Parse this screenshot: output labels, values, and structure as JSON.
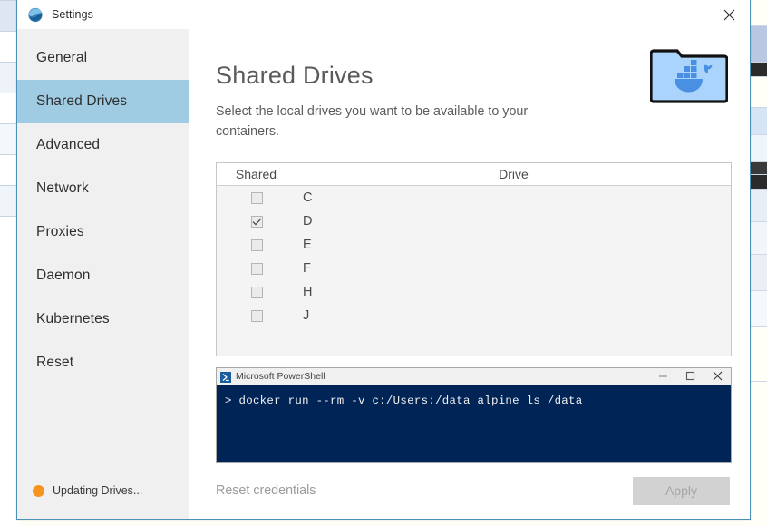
{
  "window": {
    "title": "Settings",
    "title_icon": "docker-whale-icon",
    "close_icon": "close-icon"
  },
  "background": {
    "description": "spreadsheet-behind-window"
  },
  "sidebar": {
    "items": [
      {
        "label": "General",
        "selected": false
      },
      {
        "label": "Shared Drives",
        "selected": true
      },
      {
        "label": "Advanced",
        "selected": false
      },
      {
        "label": "Network",
        "selected": false
      },
      {
        "label": "Proxies",
        "selected": false
      },
      {
        "label": "Daemon",
        "selected": false
      },
      {
        "label": "Kubernetes",
        "selected": false
      },
      {
        "label": "Reset",
        "selected": false
      }
    ],
    "status": {
      "text": "Updating Drives...",
      "dot_color": "#f79420",
      "dot_icon": "status-dot-icon"
    }
  },
  "main": {
    "title": "Shared Drives",
    "description": "Select the local drives you want to be available to your containers.",
    "hero_icon": "shared-folder-docker-icon",
    "table": {
      "columns": [
        "Shared",
        "Drive"
      ],
      "rows": [
        {
          "drive": "C",
          "shared": false
        },
        {
          "drive": "D",
          "shared": true
        },
        {
          "drive": "E",
          "shared": false
        },
        {
          "drive": "F",
          "shared": false
        },
        {
          "drive": "H",
          "shared": false
        },
        {
          "drive": "J",
          "shared": false
        }
      ]
    },
    "console": {
      "title": "Microsoft PowerShell",
      "icon": "powershell-icon",
      "prompt": ">",
      "command": "docker run --rm -v c:/Users:/data alpine ls /data",
      "line": "> docker run --rm -v c:/Users:/data alpine ls /data",
      "background_color": "#012456",
      "buttons": {
        "minimize": "minimize-icon",
        "maximize": "maximize-icon",
        "close": "close-icon"
      }
    },
    "footer": {
      "reset_credentials_label": "Reset credentials",
      "apply_label": "Apply",
      "apply_enabled": false
    }
  },
  "colors": {
    "accent_selected": "#9fcbe3",
    "window_border": "#4a90b8",
    "sidebar_bg": "#f0f0f0",
    "status_orange": "#f79420",
    "console_navy": "#012456",
    "folder_blue": "#aad4fb",
    "whale_blue": "#4a90e2"
  }
}
